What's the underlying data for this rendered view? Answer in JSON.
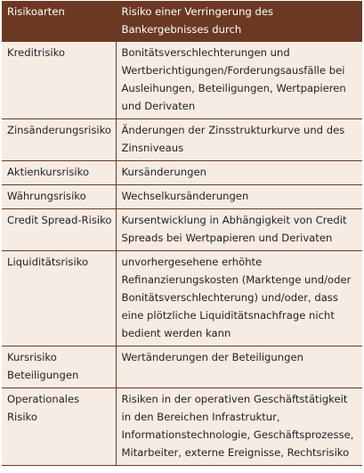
{
  "table": {
    "headers": [
      "Risikoarten",
      "Risiko einer Verringerung des Bankergebnisses durch"
    ],
    "rows": [
      {
        "type": "Kreditrisiko",
        "description": "Bonitätsverschlechterungen und Wertberichtigungen/Forderungsausfälle bei Ausleihungen, Beteiligungen, Wertpapieren und Derivaten"
      },
      {
        "type": "Zinsänderungsrisiko",
        "description": "Änderungen der Zinsstrukturkurve und des Zinsniveaus"
      },
      {
        "type": "Aktienkursrisiko",
        "description": "Kursänderungen"
      },
      {
        "type": "Währungsrisiko",
        "description": "Wechselkursänderungen"
      },
      {
        "type": "Credit Spread-Risiko",
        "description": "Kursentwicklung in Abhängigkeit von Credit Spreads bei Wertpapieren und Derivaten"
      },
      {
        "type": "Liquiditätsrisiko",
        "description": "unvorhergesehene erhöhte Refinanzierungskosten (Marktenge und/oder Bonitätsverschlechterung) und/oder, dass eine plötzliche Liquiditätsnachfrage nicht bedient werden kann"
      },
      {
        "type": "Kursrisiko Beteiligungen",
        "description": "Wertänderungen der Beteiligungen"
      },
      {
        "type": "Operationales Risiko",
        "description": "Risiken in der operativen Geschäftstätigkeit in den Bereichen Infrastruktur, Informationstechnologie, Geschäftsprozesse, Mitarbeiter, externe Ereignisse, Rechtsrisiko"
      }
    ]
  },
  "colors": {
    "header_background": "#6b3923",
    "row_background": "#f6ece4",
    "rule_color": "#6b3923"
  }
}
